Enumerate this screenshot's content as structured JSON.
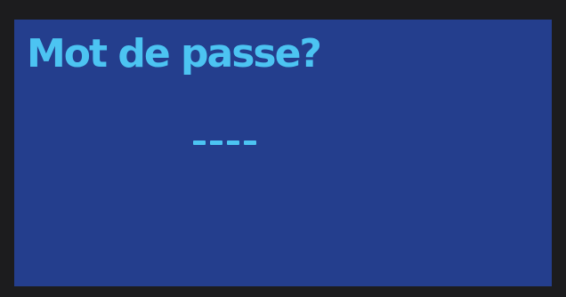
{
  "colors": {
    "bezel": "#1c1c1e",
    "screen_background": "#243e8d",
    "text": "#4cc4f2"
  },
  "screen": {
    "title": "Mot de passe?",
    "password_entry": {
      "placeholder": "----",
      "digit_count": 4
    }
  }
}
